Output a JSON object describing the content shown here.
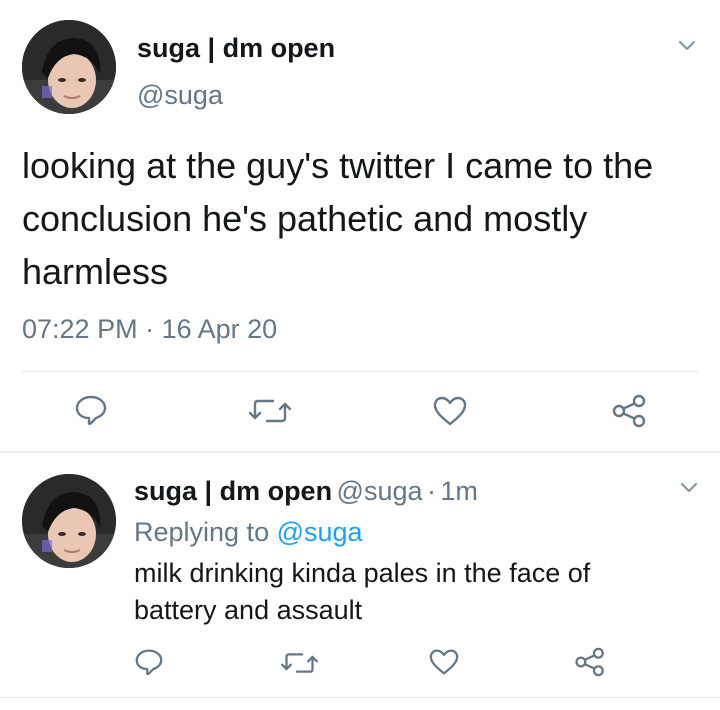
{
  "tweet": {
    "display_name": "suga | dm open",
    "handle": "@suga",
    "text": "looking at the guy's twitter I came to the conclusion he's pathetic and mostly harmless",
    "time": "07:22 PM",
    "separator": "·",
    "date": "16 Apr 20",
    "avatar_icon": "user-avatar",
    "menu_icon": "chevron-down-icon",
    "actions": [
      {
        "name": "reply-icon"
      },
      {
        "name": "retweet-icon"
      },
      {
        "name": "like-icon"
      },
      {
        "name": "share-icon"
      }
    ]
  },
  "reply": {
    "display_name": "suga | dm open",
    "handle": "@suga",
    "separator": "·",
    "age": "1m",
    "replying_prefix": "Replying to ",
    "replying_to": "@suga",
    "text": "milk drinking kinda pales in the face of battery and assault",
    "avatar_icon": "user-avatar",
    "menu_icon": "chevron-down-icon"
  },
  "colors": {
    "text": "#14171a",
    "secondary": "#657786",
    "link": "#1da1f2",
    "divider": "#e1e8ed"
  }
}
